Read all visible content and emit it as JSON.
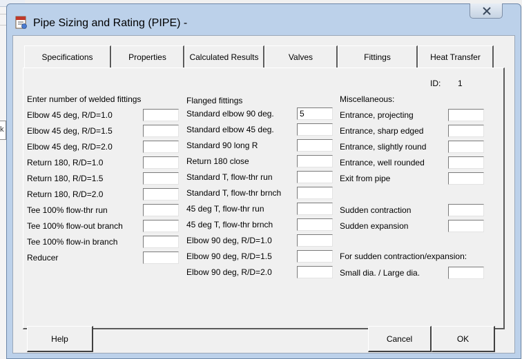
{
  "window": {
    "title": "Pipe Sizing and Rating (PIPE)  -"
  },
  "background": {
    "partial_text": "k"
  },
  "tabs": [
    {
      "label": "Specifications"
    },
    {
      "label": "Properties"
    },
    {
      "label": "Calculated Results"
    },
    {
      "label": "Valves"
    },
    {
      "label": "Fittings",
      "active": true
    },
    {
      "label": "Heat Transfer"
    }
  ],
  "id_label": "ID:",
  "id_value": "1",
  "welded": {
    "header": "Enter number of welded fittings",
    "items": [
      {
        "label": "Elbow 45 deg, R/D=1.0",
        "value": ""
      },
      {
        "label": "Elbow 45 deg, R/D=1.5",
        "value": ""
      },
      {
        "label": "Elbow 45 deg, R/D=2.0",
        "value": ""
      },
      {
        "label": "Return 180, R/D=1.0",
        "value": ""
      },
      {
        "label": "Return 180, R/D=1.5",
        "value": ""
      },
      {
        "label": "Return 180, R/D=2.0",
        "value": ""
      },
      {
        "label": "Tee 100% flow-thr run",
        "value": ""
      },
      {
        "label": "Tee 100% flow-out branch",
        "value": ""
      },
      {
        "label": "Tee 100% flow-in branch",
        "value": ""
      },
      {
        "label": "Reducer",
        "value": ""
      }
    ]
  },
  "flanged": {
    "header": "Flanged fittings",
    "items": [
      {
        "label": "Standard elbow 90 deg.",
        "value": "5"
      },
      {
        "label": "Standard elbow 45 deg.",
        "value": ""
      },
      {
        "label": "Standard 90 long R",
        "value": ""
      },
      {
        "label": "Return 180 close",
        "value": ""
      },
      {
        "label": "Standard T, flow-thr run",
        "value": ""
      },
      {
        "label": "Standard T, flow-thr brnch",
        "value": ""
      },
      {
        "label": "45 deg T, flow-thr run",
        "value": ""
      },
      {
        "label": "45 deg T, flow-thr brnch",
        "value": ""
      },
      {
        "label": "Elbow 90 deg, R/D=1.0",
        "value": ""
      },
      {
        "label": "Elbow 90 deg, R/D=1.5",
        "value": ""
      },
      {
        "label": "Elbow 90 deg, R/D=2.0",
        "value": ""
      }
    ]
  },
  "misc": {
    "header": "Miscellaneous:",
    "items": [
      {
        "label": "Entrance,  projecting",
        "value": ""
      },
      {
        "label": "Entrance, sharp edged",
        "value": ""
      },
      {
        "label": "Entrance, slightly round",
        "value": ""
      },
      {
        "label": "Entrance, well rounded",
        "value": ""
      },
      {
        "label": "Exit from pipe",
        "value": ""
      },
      {
        "label": "Sudden contraction",
        "value": ""
      },
      {
        "label": "Sudden expansion",
        "value": ""
      }
    ],
    "ratio_header": "For sudden contraction/expansion:",
    "ratio": {
      "label": "Small dia. / Large dia.",
      "value": ""
    }
  },
  "buttons": {
    "help": "Help",
    "cancel": "Cancel",
    "ok": "OK"
  },
  "colors": {
    "title_bar": "#bcd1ea",
    "dialog_bg": "#f0f0f0"
  }
}
